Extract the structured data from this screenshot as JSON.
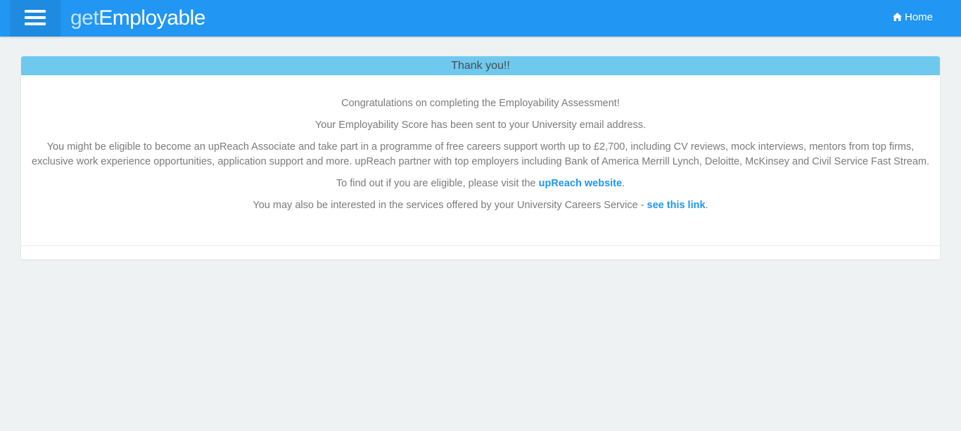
{
  "navbar": {
    "brand_prefix": "get",
    "brand_main": "Employable",
    "home_label": "Home",
    "menu_icon": "hamburger-menu-icon",
    "home_icon": "home-icon",
    "color": "#2196f3"
  },
  "panel": {
    "heading": "Thank you!!",
    "heading_color": "#6fc9ee",
    "line1": "Congratulations on completing the Employability Assessment!",
    "line2": "Your Employability Score has been sent to your University email address.",
    "line3": "You might be eligible to become an upReach Associate and take part in a programme of free careers support worth up to £2,700, including CV reviews, mock interviews, mentors from top firms, exclusive work experience opportunities, application support and more. upReach partner with top employers including Bank of America Merrill Lynch, Deloitte, McKinsey and Civil Service Fast Stream.",
    "line4_prefix": "To find out if you are eligible, please visit the ",
    "line4_link": "upReach website",
    "line4_suffix": ".",
    "line5_prefix": "You may also be interested in the services offered by your University Careers Service - ",
    "line5_link": "see this link",
    "line5_suffix": ".",
    "link_color": "#2196f3"
  }
}
